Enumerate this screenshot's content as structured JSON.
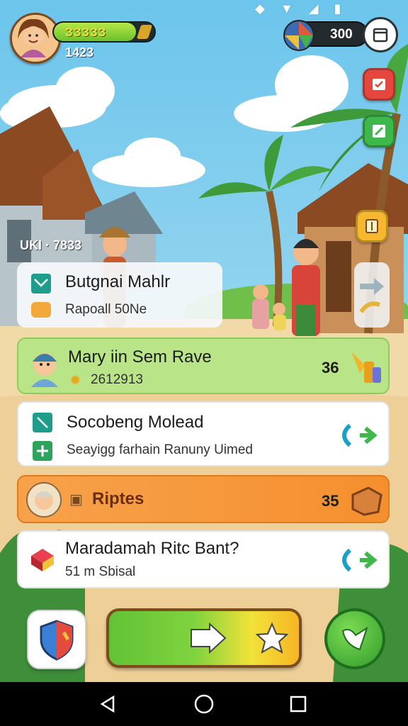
{
  "hud": {
    "xp_text": "ЗЗЗЗЗ",
    "xp_fraction": 0.82,
    "level_text": "1423",
    "coins": "300"
  },
  "ticker": "UKI · 7833",
  "cards": [
    {
      "title": "Butgnai Mahlr",
      "subtitle": "Rapoall 50Ne",
      "accent": "#e8f0f3"
    },
    {
      "title": "Mary iin Sem Rave",
      "subtitle": "2612913",
      "count": "36",
      "accent": "#b9e487"
    },
    {
      "title": "Socobeng Molead",
      "subtitle": "Seayigg farhain Ranuny Uimed",
      "accent": "#ffffff"
    },
    {
      "title": "Riptes",
      "count": "35",
      "accent": "#f7a24b"
    },
    {
      "title": "Maradamah Ritc Bant?",
      "subtitle": "51 m Sbisal",
      "accent": "#ffffff"
    }
  ],
  "icons": {
    "status": [
      "wifi-icon",
      "signal-icon",
      "battery-icon"
    ],
    "menu": "inventory-icon",
    "side": [
      "calendar-icon",
      "edit-icon",
      "map-icon"
    ],
    "bottom": [
      "shield-icon",
      "play-arrow-icon",
      "star-icon",
      "go-icon"
    ],
    "nav": [
      "back-icon",
      "home-icon",
      "recents-icon"
    ]
  },
  "colors": {
    "sky": "#87cfee",
    "sand": "#f2dcb0",
    "green_card": "#b9e487",
    "orange_card": "#f7a24b",
    "accent_teal": "#1aa0c8",
    "accent_green": "#3fb84b"
  }
}
